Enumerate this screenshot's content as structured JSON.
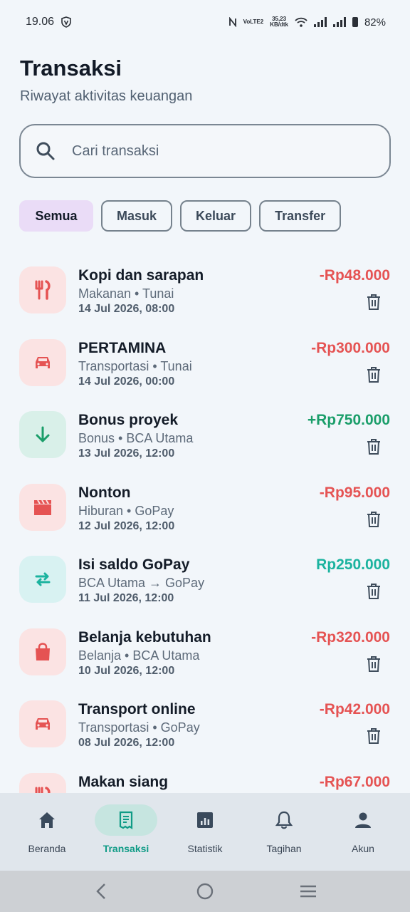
{
  "status_bar": {
    "time": "19.06",
    "network_speed_value": "35,23",
    "network_speed_unit": "KB/dtk",
    "volte_label": "VoLTE2",
    "battery": "82%"
  },
  "header": {
    "title": "Transaksi",
    "subtitle": "Riwayat aktivitas keuangan"
  },
  "search": {
    "placeholder": "Cari transaksi",
    "value": ""
  },
  "filters": [
    {
      "label": "Semua",
      "active": true
    },
    {
      "label": "Masuk",
      "active": false
    },
    {
      "label": "Keluar",
      "active": false
    },
    {
      "label": "Transfer",
      "active": false
    }
  ],
  "transactions": [
    {
      "name": "Kopi dan sarapan",
      "meta": "Makanan • Tunai",
      "date": "14 Jul 2026, 08:00",
      "amount": "-Rp48.000",
      "type": "expense",
      "icon": "utensils-icon"
    },
    {
      "name": "PERTAMINA",
      "meta": "Transportasi • Tunai",
      "date": "14 Jul 2026, 00:00",
      "amount": "-Rp300.000",
      "type": "expense",
      "icon": "car-icon"
    },
    {
      "name": "Bonus proyek",
      "meta": "Bonus • BCA Utama",
      "date": "13 Jul 2026, 12:00",
      "amount": "+Rp750.000",
      "type": "income",
      "icon": "arrow-down-icon"
    },
    {
      "name": "Nonton",
      "meta": "Hiburan • GoPay",
      "date": "12 Jul 2026, 12:00",
      "amount": "-Rp95.000",
      "type": "expense",
      "icon": "clapperboard-icon"
    },
    {
      "name": "Isi saldo GoPay",
      "meta": "BCA Utama → GoPay",
      "date": "11 Jul 2026, 12:00",
      "amount": "Rp250.000",
      "type": "transfer",
      "icon": "transfer-arrows-icon"
    },
    {
      "name": "Belanja kebutuhan",
      "meta": "Belanja • BCA Utama",
      "date": "10 Jul 2026, 12:00",
      "amount": "-Rp320.000",
      "type": "expense",
      "icon": "shopping-bag-icon"
    },
    {
      "name": "Transport online",
      "meta": "Transportasi • GoPay",
      "date": "08 Jul 2026, 12:00",
      "amount": "-Rp42.000",
      "type": "expense",
      "icon": "car-icon"
    },
    {
      "name": "Makan siang",
      "meta": "",
      "date": "",
      "amount": "-Rp67.000",
      "type": "expense",
      "icon": "utensils-icon"
    }
  ],
  "bottom_nav": [
    {
      "label": "Beranda",
      "icon": "home-icon",
      "active": false
    },
    {
      "label": "Transaksi",
      "icon": "receipt-icon",
      "active": true
    },
    {
      "label": "Statistik",
      "icon": "chart-icon",
      "active": false
    },
    {
      "label": "Tagihan",
      "icon": "bell-icon",
      "active": false
    },
    {
      "label": "Akun",
      "icon": "person-icon",
      "active": false
    }
  ],
  "colors": {
    "expense": "#e55353",
    "income": "#1b9e6a",
    "transfer": "#1bb39f",
    "accent": "#0f9b86",
    "chip_active_bg": "#eadcf7"
  }
}
